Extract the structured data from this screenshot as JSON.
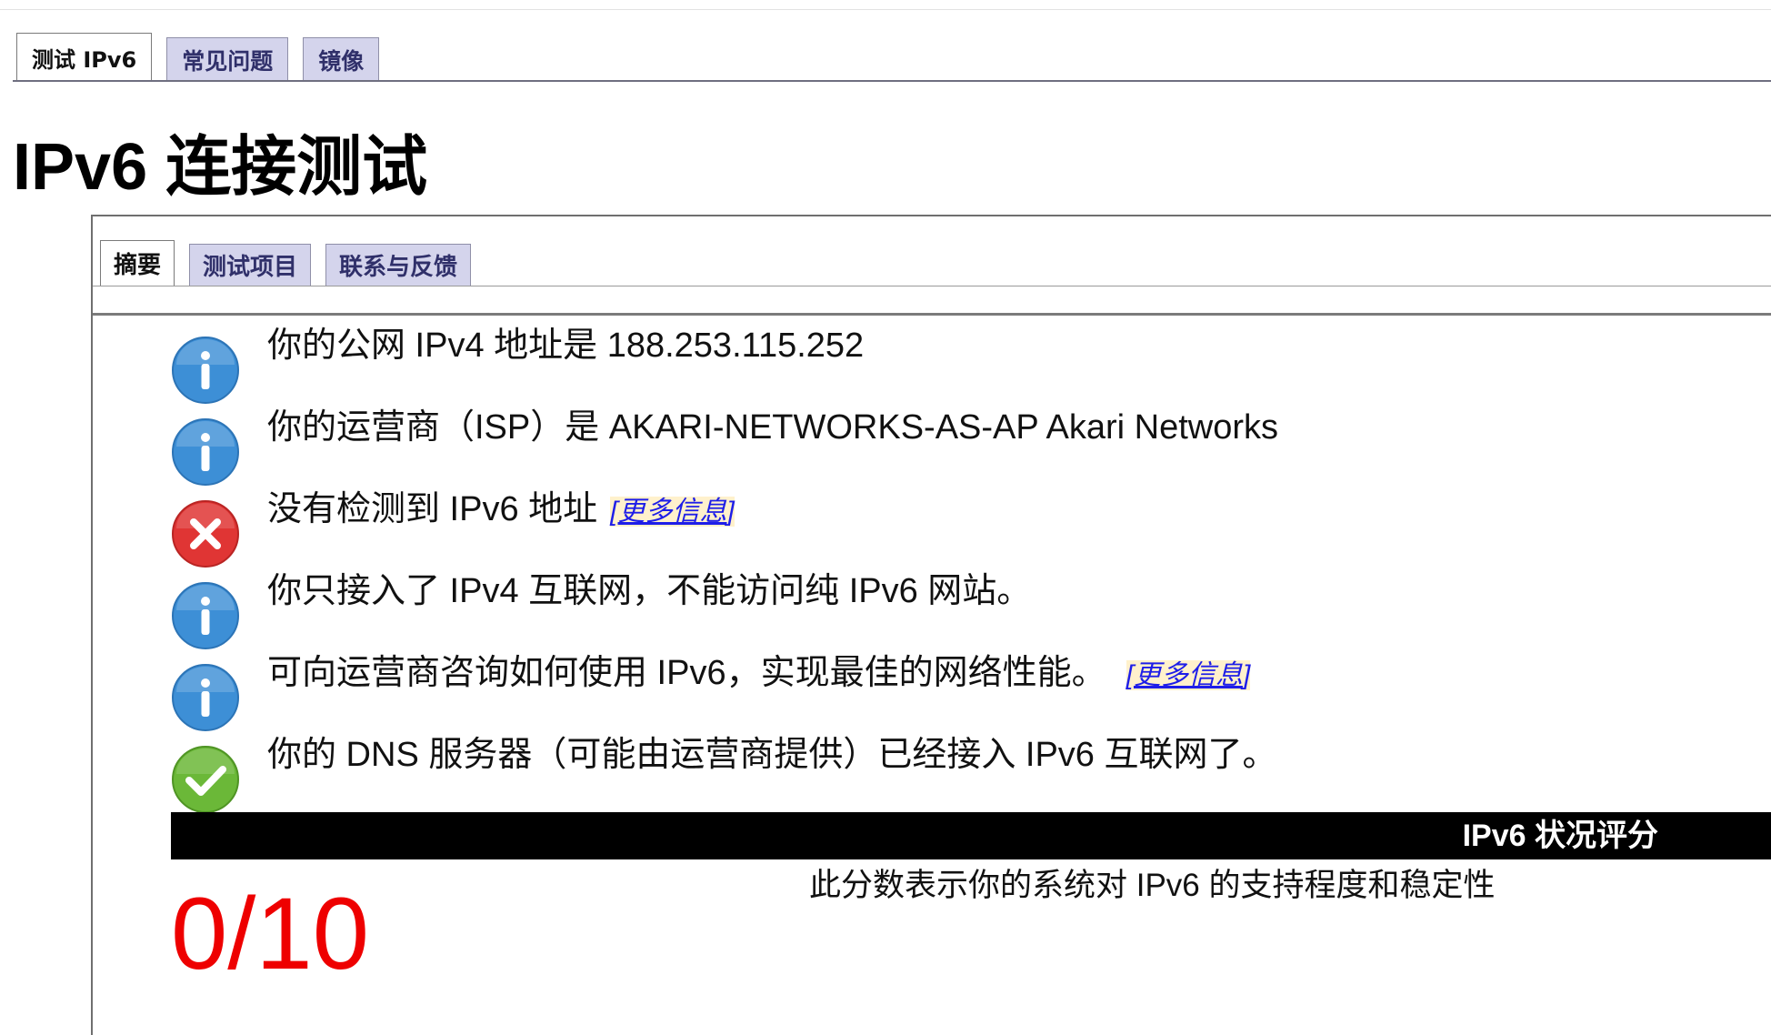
{
  "outer_tabs": [
    "测试 IPv6",
    "常见问题",
    "镜像"
  ],
  "page_title": "IPv6 连接测试",
  "inner_tabs": [
    "摘要",
    "测试项目",
    "联系与反馈"
  ],
  "results": [
    {
      "status": "info",
      "text": "你的公网 IPv4 地址是 188.253.115.252",
      "link": ""
    },
    {
      "status": "info",
      "text": "你的运营商（ISP）是 AKARI-NETWORKS-AS-AP Akari Networks",
      "link": ""
    },
    {
      "status": "error",
      "text": "没有检测到 IPv6 地址",
      "link": "更多信息"
    },
    {
      "status": "info",
      "text": "你只接入了 IPv4 互联网，不能访问纯 IPv6 网站。",
      "link": ""
    },
    {
      "status": "info",
      "text": "可向运营商咨询如何使用 IPv6，实现最佳的网络性能。",
      "link": "更多信息"
    },
    {
      "status": "ok",
      "text": "你的 DNS 服务器（可能由运营商提供）已经接入 IPv6 互联网了。",
      "link": ""
    }
  ],
  "score": {
    "heading": "IPv6 状况评分",
    "value": "0/10",
    "description": "此分数表示你的系统对 IPv6 的支持程度和稳定性"
  },
  "icons": {
    "info": "info-icon",
    "error": "error-icon",
    "ok": "checkmark-icon"
  },
  "colors": {
    "info": "#3d8fd6",
    "error": "#e03534",
    "ok": "#6bb838",
    "score": "#ee0000",
    "link": "#1e1ee8"
  }
}
